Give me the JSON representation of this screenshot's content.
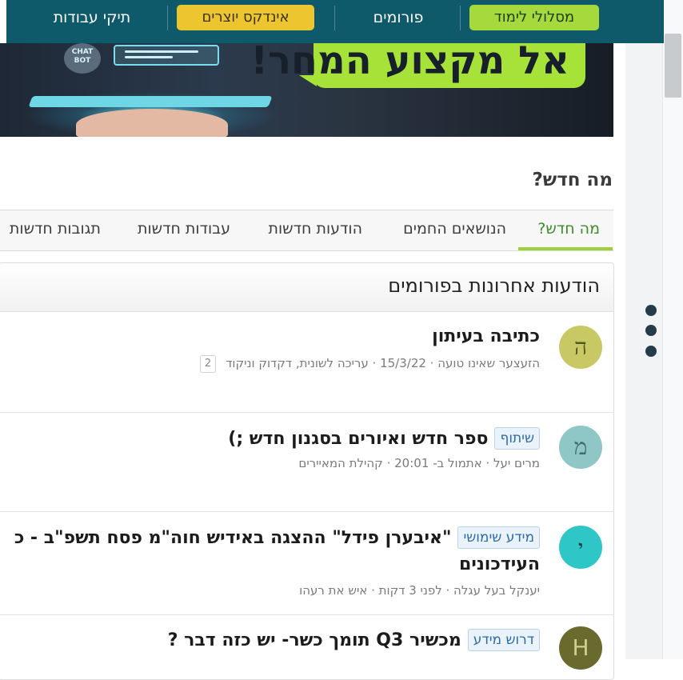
{
  "nav": {
    "learning_paths": "מסלולי לימוד",
    "forums": "פורומים",
    "creators_index": "אינדקס יוצרים",
    "portfolios": "תיקי עבודות"
  },
  "banner": {
    "headline": "אל מקצוע המחר!",
    "bot_label": "CHAT BOT"
  },
  "whats_new": {
    "title": "מה חדש?",
    "tabs": [
      "מה חדש?",
      "הנושאים החמים",
      "הודעות חדשות",
      "עבודות חדשות",
      "תגובות חדשות"
    ]
  },
  "panel": {
    "title": "הודעות אחרונות בפורומים",
    "posts": [
      {
        "avatar": "ה",
        "avatar_color": "#c8c864",
        "title": "כתיבה בעיתון",
        "tag": "",
        "meta": "הזעצער שאינו טועה · 15/3/22 · עריכה לשונית, דקדוק וניקוד",
        "pages": "2"
      },
      {
        "avatar": "מ",
        "avatar_color": "#8fc6c6",
        "title": "ספר חדש ואיורים בסגנון חדש ;)",
        "tag": "שיתוף",
        "meta": "מרים יעל · אתמול ב- 20:01 · קהילת המאיירים"
      },
      {
        "avatar": "י",
        "avatar_color": "#2ec6c6",
        "title": "\"איבערן פידל\" ההצגה באידיש חוה\"מ פסח תשפ\"ב - כ",
        "title_line2": "העידכונים",
        "tag": "מידע שימושי",
        "meta": "יענקל בעל עגלה · לפני 3 דקות · איש את רעהו"
      },
      {
        "avatar": "H",
        "avatar_color": "#6a6a2e",
        "title": "מכשיר Q3 תומך כשר- יש כזה דבר ?",
        "tag": "דרוש מידע",
        "meta": ""
      }
    ]
  }
}
